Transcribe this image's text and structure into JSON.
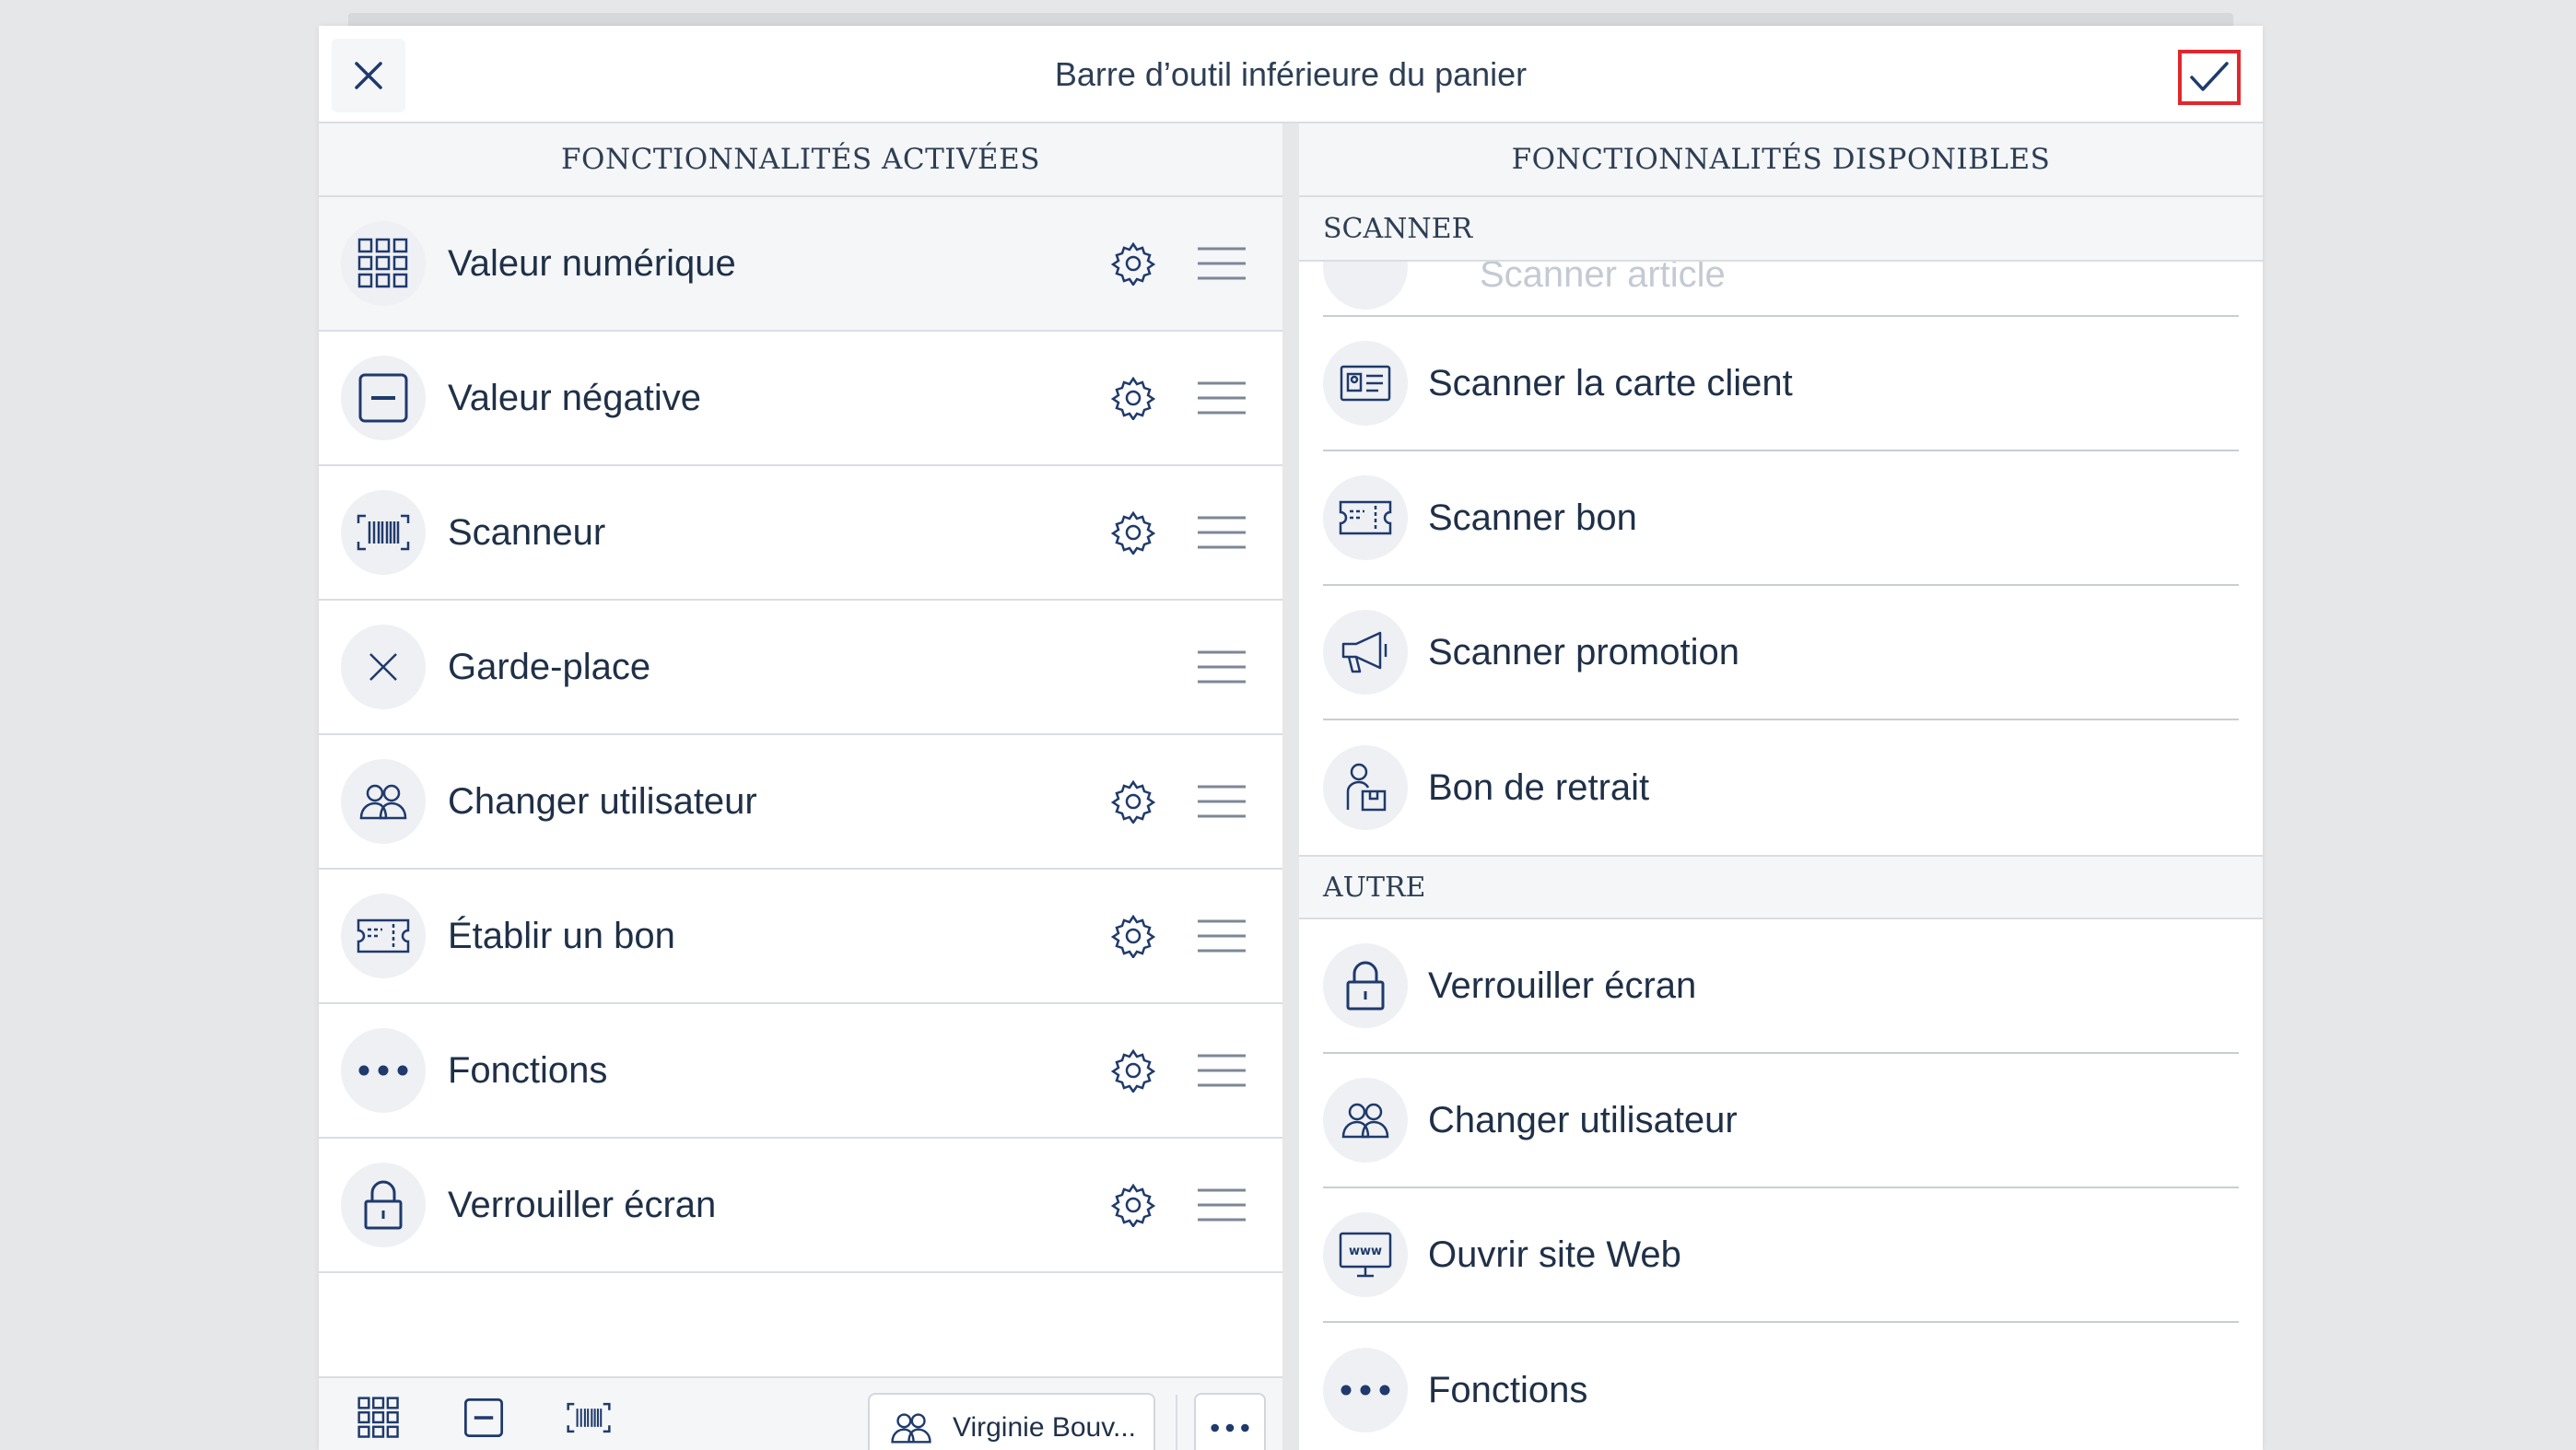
{
  "dialog": {
    "title": "Barre d’outil inférieure du panier"
  },
  "left": {
    "heading": "FONCTIONNALITÉS ACTIVÉES",
    "items": [
      {
        "label": "Valeur numérique",
        "icon": "numpad-icon",
        "has_settings": true
      },
      {
        "label": "Valeur négative",
        "icon": "minus-box-icon",
        "has_settings": true
      },
      {
        "label": "Scanneur",
        "icon": "barcode-scanner-icon",
        "has_settings": true
      },
      {
        "label": "Garde-place",
        "icon": "placeholder-x-icon",
        "has_settings": false
      },
      {
        "label": "Changer utilisateur",
        "icon": "users-icon",
        "has_settings": true
      },
      {
        "label": "Établir un bon",
        "icon": "voucher-icon",
        "has_settings": true
      },
      {
        "label": "Fonctions",
        "icon": "more-dots-icon",
        "has_settings": true
      },
      {
        "label": "Verrouiller écran",
        "icon": "lock-icon",
        "has_settings": true
      }
    ]
  },
  "right": {
    "heading": "FONCTIONNALITÉS DISPONIBLES",
    "sections": [
      {
        "title": "SCANNER",
        "partial_item": "Scanner article",
        "items": [
          {
            "label": "Scanner la carte client",
            "icon": "customer-card-icon"
          },
          {
            "label": "Scanner bon",
            "icon": "voucher-icon"
          },
          {
            "label": "Scanner promotion",
            "icon": "megaphone-icon"
          },
          {
            "label": "Bon de retrait",
            "icon": "pickup-person-icon"
          }
        ]
      },
      {
        "title": "AUTRE",
        "items": [
          {
            "label": "Verrouiller écran",
            "icon": "lock-icon"
          },
          {
            "label": "Changer utilisateur",
            "icon": "users-icon"
          },
          {
            "label": "Ouvrir site Web",
            "icon": "www-monitor-icon"
          },
          {
            "label": "Fonctions",
            "icon": "more-dots-icon"
          }
        ]
      }
    ]
  },
  "toolbar": {
    "user_label": "Virginie Bouv..."
  },
  "colors": {
    "accent": "#1f3a6b",
    "highlight_border": "#e0282c",
    "background": "#e6e7e9"
  }
}
